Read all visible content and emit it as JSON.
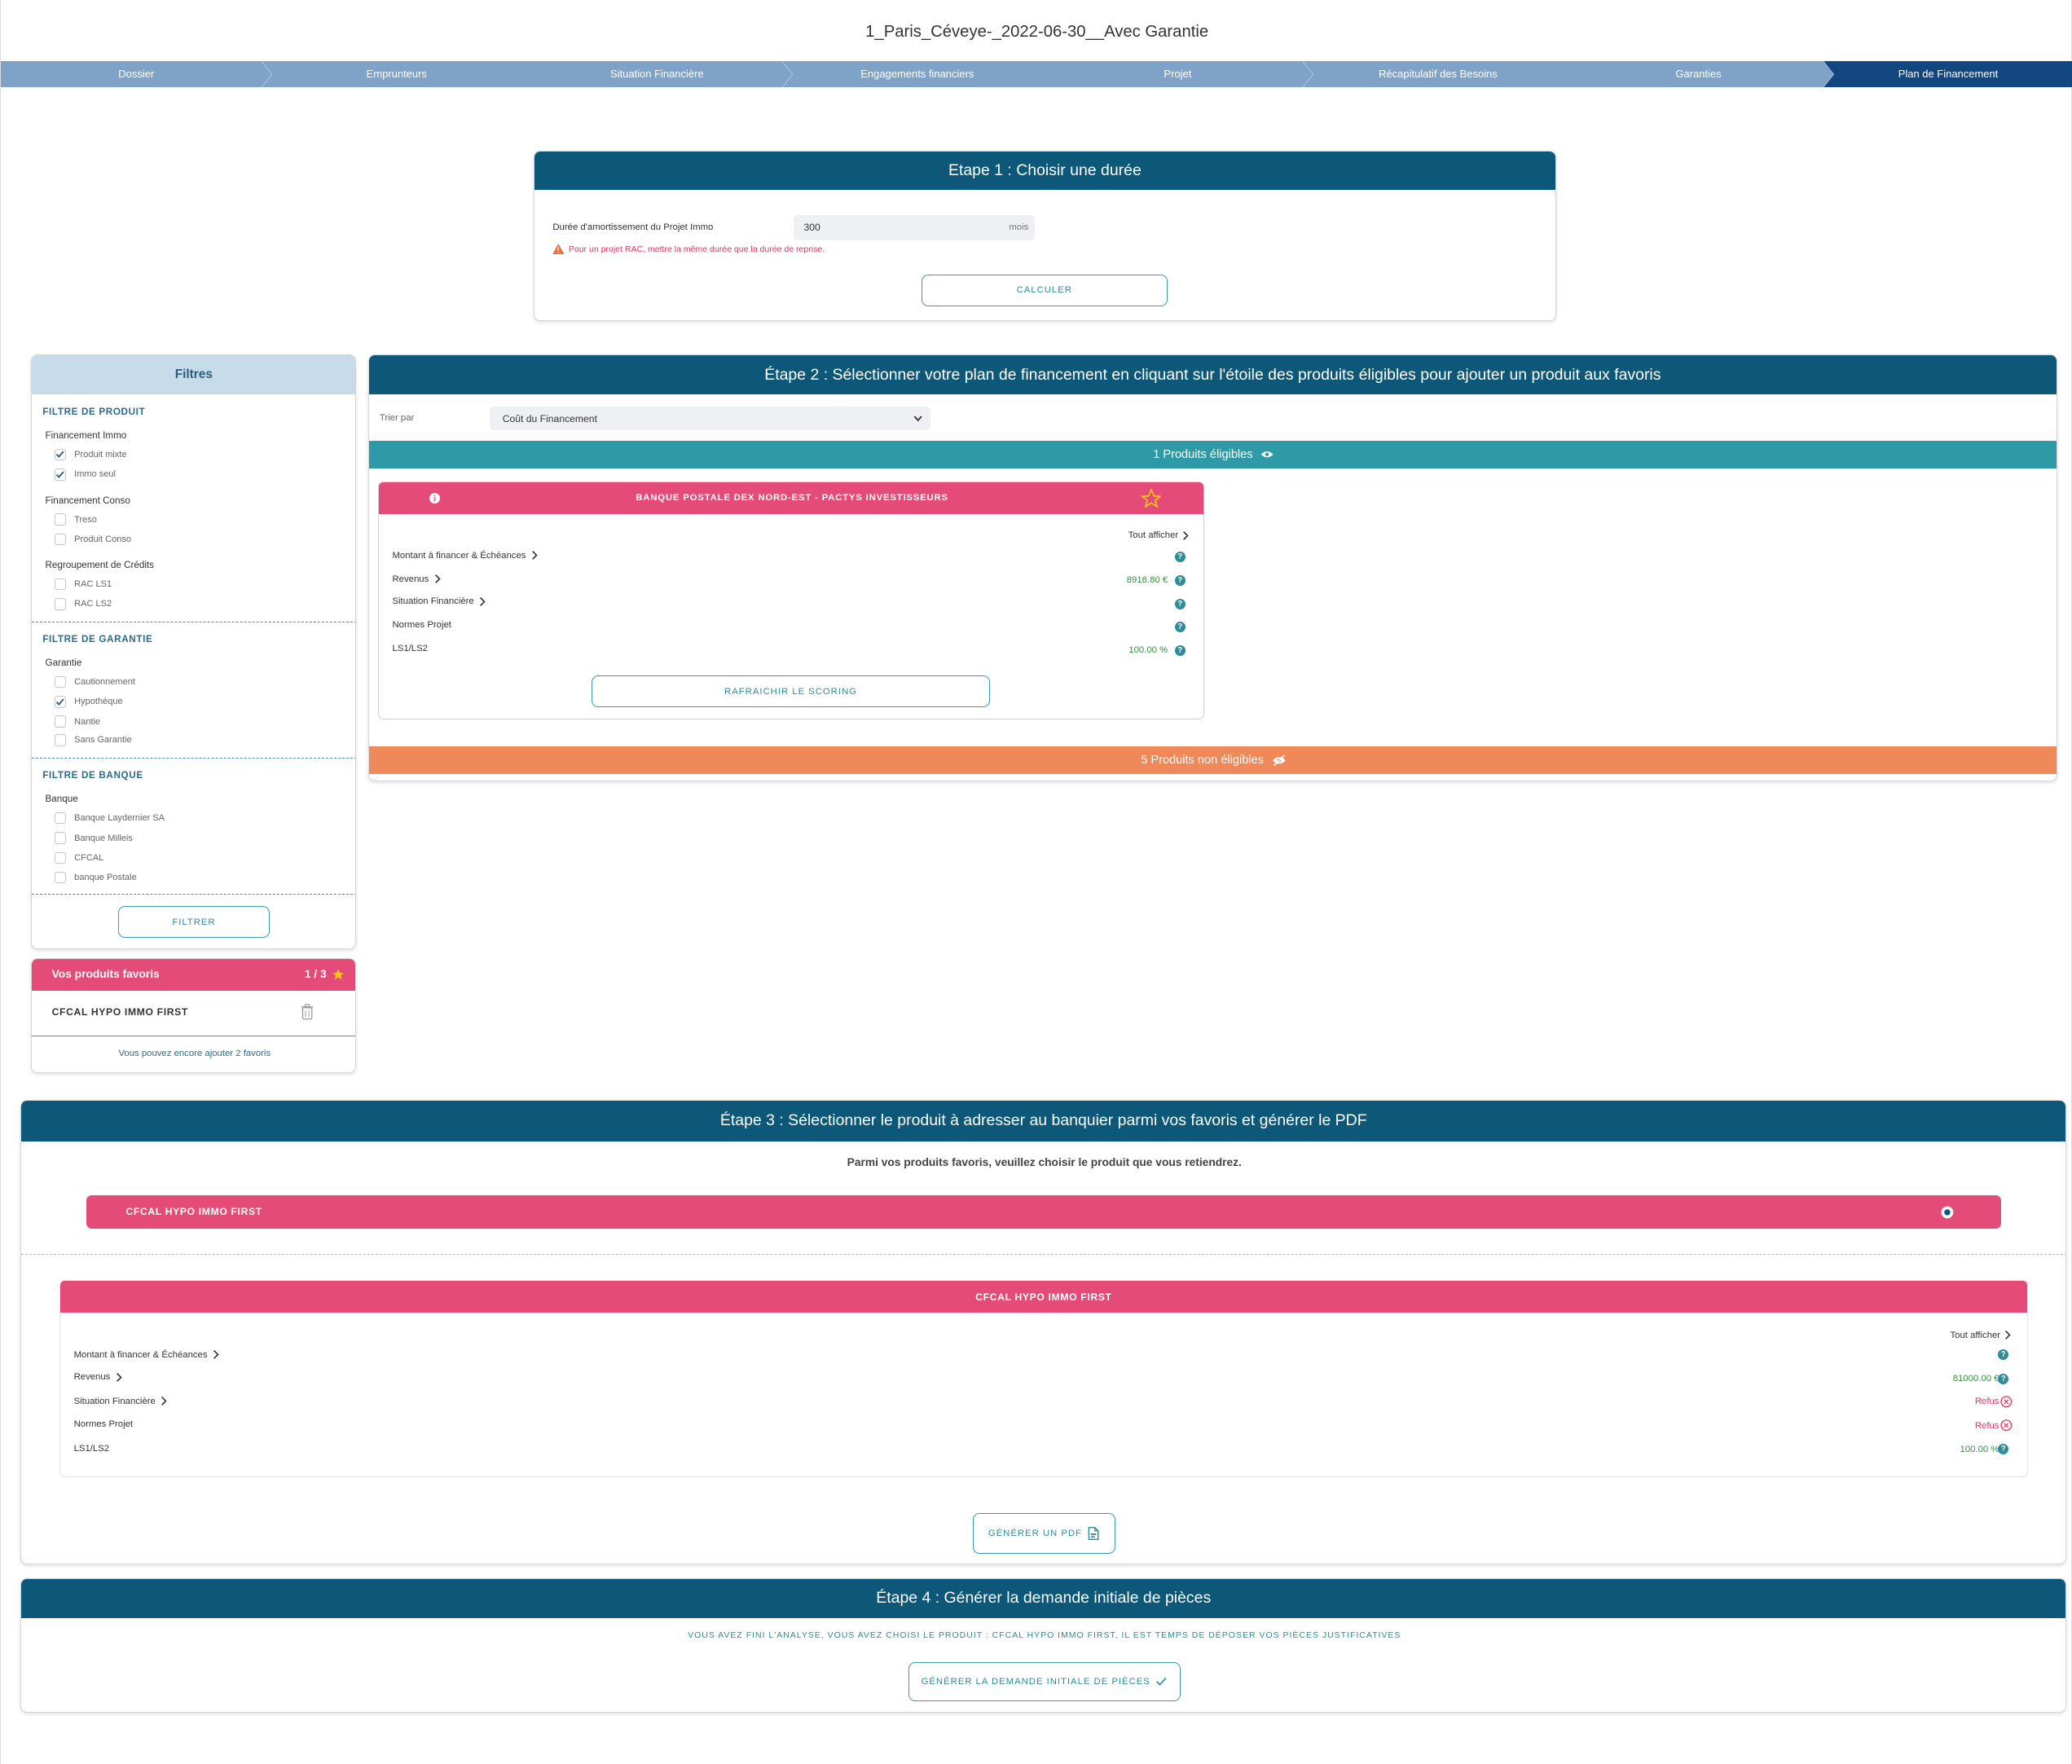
{
  "title": "1_Paris_Céveye-_2022-06-30__Avec Garantie",
  "steps": [
    "Dossier",
    "Emprunteurs",
    "Situation Financière",
    "Engagements financiers",
    "Projet",
    "Récapitulatif des Besoins",
    "Garanties",
    "Plan de Financement"
  ],
  "colors": {
    "step_done": "#7fa3c8",
    "step_active": "#12467e",
    "header": "#0d5878",
    "pink": "#e54b78",
    "teal": "#2e9aa7",
    "orange": "#f0895a"
  },
  "etape1": {
    "title": "Etape 1 : Choisir une durée",
    "duration_label": "Durée d'amortissement du Projet Immo",
    "duration_value": "300",
    "duration_unit": "mois",
    "warning": "Pour un projet RAC, mettre la même durée que la durée de reprise.",
    "calc_button": "CALCULER"
  },
  "filters": {
    "title": "Filtres",
    "product": {
      "title": "FILTRE DE PRODUIT",
      "groups": [
        {
          "label": "Financement Immo",
          "items": [
            {
              "label": "Produit mixte",
              "checked": true
            },
            {
              "label": "Immo seul",
              "checked": true
            }
          ]
        },
        {
          "label": "Financement Conso",
          "items": [
            {
              "label": "Treso",
              "checked": false
            },
            {
              "label": "Produit Conso",
              "checked": false
            }
          ]
        },
        {
          "label": "Regroupement de Crédits",
          "items": [
            {
              "label": "RAC LS1",
              "checked": false
            },
            {
              "label": "RAC LS2",
              "checked": false
            }
          ]
        }
      ]
    },
    "guarantee": {
      "title": "FILTRE DE GARANTIE",
      "group": "Garantie",
      "items": [
        {
          "label": "Cautionnement",
          "checked": false
        },
        {
          "label": "Hypothèque",
          "checked": true
        },
        {
          "label": "Nantie",
          "checked": false
        },
        {
          "label": "Sans Garantie",
          "checked": false
        }
      ]
    },
    "bank": {
      "title": "FILTRE DE BANQUE",
      "group": "Banque",
      "items": [
        {
          "label": "Banque Laydernier SA",
          "checked": false
        },
        {
          "label": "Banque Milleis",
          "checked": false
        },
        {
          "label": "CFCAL",
          "checked": false
        },
        {
          "label": "banque Postale",
          "checked": false
        }
      ]
    },
    "button": "FILTRER"
  },
  "favorites": {
    "title": "Vos produits favoris",
    "count": "1 / 3",
    "item": "CFCAL HYPO IMMO FIRST",
    "footer": "Vous pouvez encore ajouter 2 favoris"
  },
  "etape2": {
    "title": "Étape 2 : Sélectionner votre plan de financement en cliquant sur l'étoile des produits éligibles pour ajouter un produit aux favoris",
    "sort_label": "Trier par",
    "sort_value": "Coût du Financement",
    "eligible": "1 Produits éligibles",
    "non_eligible": "5 Produits non éligibles",
    "product": {
      "name": "BANQUE POSTALE DEX NORD-EST - PACTYS INVESTISSEURS",
      "show_all": "Tout afficher",
      "rows": [
        {
          "label": "Montant à financer & Échéances",
          "value": ""
        },
        {
          "label": "Revenus",
          "value": "8916.80 €"
        },
        {
          "label": "Situation Financière",
          "value": ""
        },
        {
          "label": "Normes Projet",
          "value": ""
        },
        {
          "label": "LS1/LS2",
          "value": "100.00 %"
        }
      ],
      "refresh_button": "RAFRAICHIR LE SCORING"
    }
  },
  "etape3": {
    "title": "Étape 3 : Sélectionner le produit à adresser au banquier parmi vos favoris et générer le PDF",
    "subtitle": "Parmi vos produits favoris, veuillez choisir le produit que vous retiendrez.",
    "option": "CFCAL HYPO IMMO FIRST",
    "detail": {
      "name": "CFCAL HYPO IMMO FIRST",
      "show_all": "Tout afficher",
      "rows": [
        {
          "label": "Montant à financer & Échéances",
          "value": ""
        },
        {
          "label": "Revenus",
          "value": "81000.00 €"
        },
        {
          "label": "Situation Financière",
          "value": "Refus"
        },
        {
          "label": "Normes Projet",
          "value": "Refus"
        },
        {
          "label": "LS1/LS2",
          "value": "100.00 %"
        }
      ]
    },
    "pdf_button": "GÉNÉRER UN PDF"
  },
  "etape4": {
    "title": "Étape 4 : Générer la demande initiale de pièces",
    "message": "VOUS AVEZ FINI L'ANALYSE, VOUS AVEZ CHOISI LE PRODUIT : CFCAL HYPO IMMO FIRST, IL EST TEMPS DE DÉPOSER VOS PIÈCES JUSTIFICATIVES",
    "button": "GÉNÉRER LA DEMANDE INITIALE DE PIÈCES"
  }
}
